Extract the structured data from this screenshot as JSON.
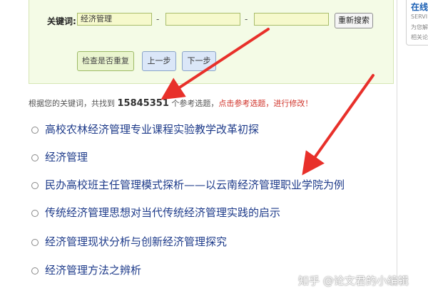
{
  "search_panel": {
    "keyword_label": "关键词:",
    "inputs": [
      "经济管理",
      "",
      ""
    ],
    "separator": "-",
    "research_button": "重新搜索",
    "check_button": "检查是否重复",
    "prev_button": "上一步",
    "next_button": "下一步"
  },
  "result_summary": {
    "prefix": "根据您的关键词，共找到",
    "count": "15845351",
    "middle": "个参考选题，",
    "hint": "点击参考选题，进行修改！"
  },
  "results": [
    "高校农林经济管理专业课程实验教学改革初探",
    "经济管理",
    "民办高校班主任管理模式探析——以云南经济管理职业学院为例",
    "传统经济管理思想对当代传统经济管理实践的启示",
    "经济管理现状分析与创新经济管理探究",
    "经济管理方法之辨析"
  ],
  "sidebar": {
    "title": "在线",
    "line1": "SERVI",
    "line2": "为您解",
    "line3": "相关论"
  },
  "watermark": "知乎 @论文君的小编辑",
  "colors": {
    "panel_bg": "#f4fbe6",
    "link": "#1e3b8a",
    "hint_red": "#d0342b",
    "arrow_red": "#e8302a"
  }
}
